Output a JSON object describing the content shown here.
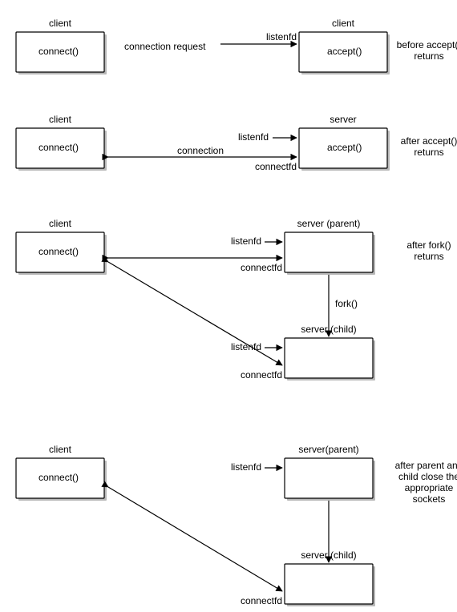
{
  "diagram": {
    "scene1": {
      "client_title": "client",
      "client_call": "connect()",
      "server_title": "client",
      "server_call": "accept()",
      "edge_label": "connection request",
      "port_right": "listenfd",
      "caption": "before accept() returns"
    },
    "scene2": {
      "client_title": "client",
      "client_call": "connect()",
      "server_title": "server",
      "server_call": "accept()",
      "edge_label": "connection",
      "port_top": "listenfd",
      "port_bottom": "connectfd",
      "caption": "after accept() returns"
    },
    "scene3": {
      "client_title": "client",
      "client_call": "connect()",
      "parent_title": "server (parent)",
      "parent_port_top": "listenfd",
      "parent_port_bottom": "connectfd",
      "fork_label": "fork()",
      "child_title": "server (child)",
      "child_port_top": "listenfd",
      "child_port_bottom": "connectfd",
      "caption": "after fork() returns"
    },
    "scene4": {
      "client_title": "client",
      "client_call": "connect()",
      "parent_title": "server(parent)",
      "parent_port": "listenfd",
      "child_title": "server (child)",
      "child_port": "connectfd",
      "caption": "after parent and child close the appropriate sockets"
    }
  }
}
